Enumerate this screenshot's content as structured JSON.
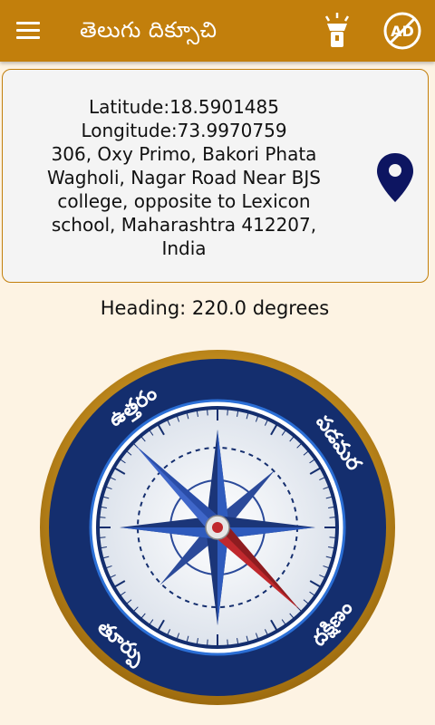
{
  "app": {
    "title": "తెలుగు దిక్సూచి"
  },
  "toolbar": {
    "menu_icon": "hamburger-menu-icon",
    "torch_icon": "flashlight-icon",
    "noads_icon": "no-ads-icon",
    "noads_label": "AD"
  },
  "location": {
    "latitude": "Latitude:18.5901485",
    "longitude": "Longitude:73.9970759",
    "address_lines": [
      "306, Oxy Primo, Bakori Phata",
      "Wagholi, Nagar Road Near BJS",
      "college, opposite to Lexicon",
      "school, Maharashtra 412207,",
      "India"
    ],
    "pin_icon": "location-pin-icon"
  },
  "compass": {
    "heading_text": "Heading: 220.0 degrees",
    "heading_degrees": 220.0,
    "labels": {
      "north": "ఉత్తరం",
      "east": "తూర్పు",
      "south": "దక్షిణం",
      "west": "పడమర"
    }
  },
  "colors": {
    "appbar": "#c27f0c",
    "background": "#fdf3e3",
    "compass_ring": "#142e6e",
    "needle_red": "#c0282d",
    "pin": "#0d1561"
  }
}
